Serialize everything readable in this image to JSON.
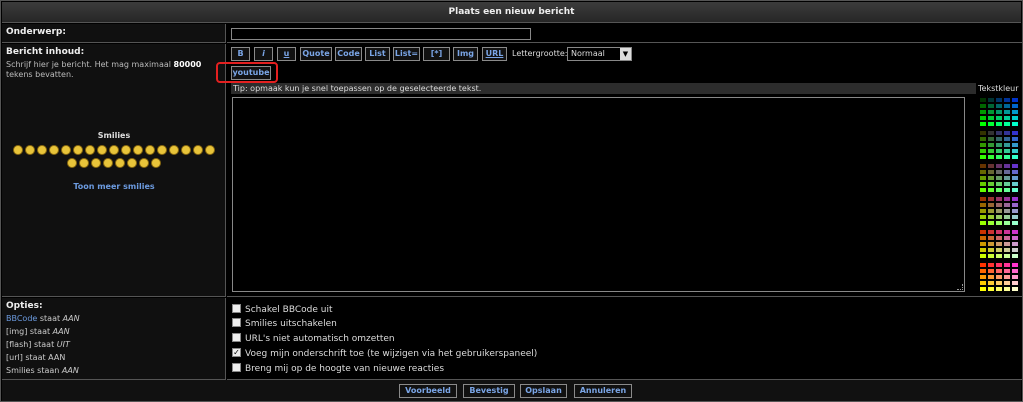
{
  "header": {
    "title": "Plaats een nieuw bericht"
  },
  "subject": {
    "label": "Onderwerp:",
    "value": ""
  },
  "message": {
    "label": "Bericht inhoud:",
    "desc_prefix": "Schrijf hier je bericht. Het mag maximaal ",
    "desc_max": "80000",
    "desc_suffix": " tekens bevatten."
  },
  "toolbar": {
    "buttons": [
      "B",
      "i",
      "u",
      "Quote",
      "Code",
      "List",
      "List=",
      "[*]",
      "Img",
      "URL"
    ],
    "youtube": "youtube",
    "fontsize_label": "Lettergrootte:",
    "fontsize_value": "Normaal",
    "fontsize_arrow": "▼"
  },
  "tip": "Tip: opmaak kun je snel toepassen op de geselecteerde tekst.",
  "text_color": {
    "label": "Tekstkleur",
    "colors": [
      [
        "#003300",
        "#003333",
        "#003366",
        "#003399",
        "#0033cc"
      ],
      [
        "#006600",
        "#006633",
        "#006666",
        "#006699",
        "#0066cc"
      ],
      [
        "#009900",
        "#009933",
        "#009966",
        "#009999",
        "#0099cc"
      ],
      [
        "#00cc00",
        "#00cc33",
        "#00cc66",
        "#00cc99",
        "#00cccc"
      ],
      [
        "#00ff00",
        "#00ff33",
        "#00ff66",
        "#00ff99",
        "#00ffcc"
      ],
      [
        "#333300",
        "#333333",
        "#333366",
        "#333399",
        "#3333cc"
      ],
      [
        "#336600",
        "#336633",
        "#336666",
        "#336699",
        "#3366cc"
      ],
      [
        "#339900",
        "#339933",
        "#339966",
        "#339999",
        "#3399cc"
      ],
      [
        "#33cc00",
        "#33cc33",
        "#33cc66",
        "#33cc99",
        "#33cccc"
      ],
      [
        "#33ff00",
        "#33ff33",
        "#33ff66",
        "#33ff99",
        "#33ffcc"
      ],
      [
        "#663300",
        "#663333",
        "#663366",
        "#663399",
        "#6633cc"
      ],
      [
        "#666600",
        "#666633",
        "#666666",
        "#666699",
        "#6666cc"
      ],
      [
        "#669900",
        "#669933",
        "#669966",
        "#669999",
        "#6699cc"
      ],
      [
        "#66cc00",
        "#66cc33",
        "#66cc66",
        "#66cc99",
        "#66cccc"
      ],
      [
        "#66ff00",
        "#66ff33",
        "#66ff66",
        "#66ff99",
        "#66ffcc"
      ],
      [
        "#993300",
        "#993333",
        "#993366",
        "#993399",
        "#9933cc"
      ],
      [
        "#996600",
        "#996633",
        "#996666",
        "#996699",
        "#9966cc"
      ],
      [
        "#999900",
        "#999933",
        "#999966",
        "#999999",
        "#9999cc"
      ],
      [
        "#99cc00",
        "#99cc33",
        "#99cc66",
        "#99cc99",
        "#99cccc"
      ],
      [
        "#99ff00",
        "#99ff33",
        "#99ff66",
        "#99ff99",
        "#99ffcc"
      ],
      [
        "#cc3300",
        "#cc3333",
        "#cc3366",
        "#cc3399",
        "#cc33cc"
      ],
      [
        "#cc6600",
        "#cc6633",
        "#cc6666",
        "#cc6699",
        "#cc66cc"
      ],
      [
        "#cc9900",
        "#cc9933",
        "#cc9966",
        "#cc9999",
        "#cc99cc"
      ],
      [
        "#cccc00",
        "#cccc33",
        "#cccc66",
        "#cccc99",
        "#cccccc"
      ],
      [
        "#ccff00",
        "#ccff33",
        "#ccff66",
        "#ccff99",
        "#ccffcc"
      ],
      [
        "#ff3300",
        "#ff3333",
        "#ff3366",
        "#ff3399",
        "#ff33cc"
      ],
      [
        "#ff6600",
        "#ff6633",
        "#ff6666",
        "#ff6699",
        "#ff66cc"
      ],
      [
        "#ff9900",
        "#ff9933",
        "#ff9966",
        "#ff9999",
        "#ff99cc"
      ],
      [
        "#ffcc00",
        "#ffcc33",
        "#ffcc66",
        "#ffcc99",
        "#ffcccc"
      ],
      [
        "#ffff00",
        "#ffff33",
        "#ffff66",
        "#ffff99",
        "#ffffcc"
      ]
    ]
  },
  "smilies": {
    "title": "Smilies",
    "more": "Toon meer smilies",
    "count": 25
  },
  "options": {
    "label": "Opties:",
    "status": [
      {
        "link": "BBCode",
        "text": " staat ",
        "state": "AAN"
      },
      {
        "link": "",
        "text": "[img] staat ",
        "state": "AAN"
      },
      {
        "link": "",
        "text": "[flash] staat ",
        "state": "UIT"
      },
      {
        "link": "",
        "text": "[url] staat AAN",
        "state": ""
      },
      {
        "link": "",
        "text": "Smilies staan ",
        "state": "AAN"
      }
    ],
    "checkboxes": [
      {
        "label": "Schakel BBCode uit",
        "checked": false
      },
      {
        "label": "Smilies uitschakelen",
        "checked": false
      },
      {
        "label": "URL's niet automatisch omzetten",
        "checked": false
      },
      {
        "label": "Voeg mijn onderschrift toe (te wijzigen via het gebruikerspaneel)",
        "checked": true
      },
      {
        "label": "Breng mij op de hoogte van nieuwe reacties",
        "checked": false
      }
    ]
  },
  "footer": {
    "buttons": [
      "Voorbeeld",
      "Bevestig",
      "Opslaan",
      "Annuleren"
    ]
  },
  "highlight_color": "#e32020"
}
